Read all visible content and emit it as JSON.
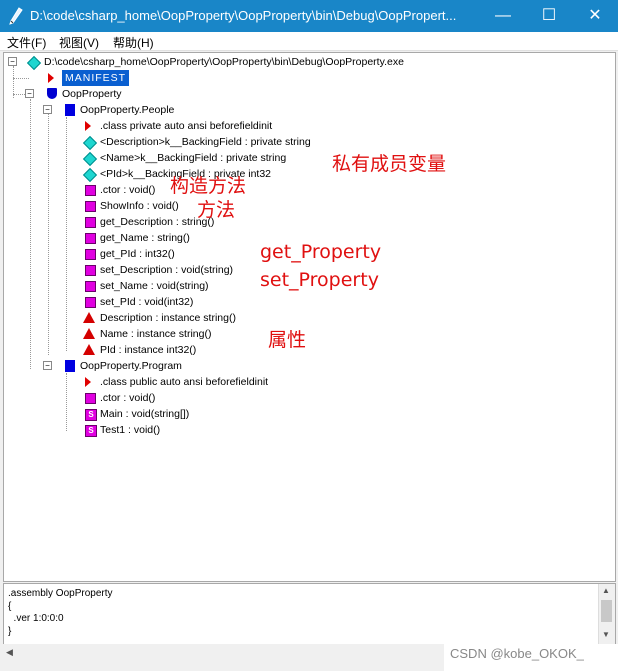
{
  "window": {
    "title": "D:\\code\\csharp_home\\OopProperty\\OopProperty\\bin\\Debug\\OopPropert...",
    "minimize": "—",
    "maximize": "☐",
    "close": "✕"
  },
  "menu": [
    {
      "label": "文件(F)"
    },
    {
      "label": "视图(V)"
    },
    {
      "label": "帮助(H)"
    }
  ],
  "tree": {
    "root": "D:\\code\\csharp_home\\OopProperty\\OopProperty\\bin\\Debug\\OopProperty.exe",
    "manifest": "MANIFEST",
    "namespace": "OopProperty",
    "people": {
      "name": "OopProperty.People",
      "members": [
        ".class private auto ansi beforefieldinit",
        "<Description>k__BackingField : private string",
        "<Name>k__BackingField : private string",
        "<PId>k__BackingField : private int32",
        ".ctor : void()",
        "ShowInfo : void()",
        "get_Description : string()",
        "get_Name : string()",
        "get_PId : int32()",
        "set_Description : void(string)",
        "set_Name : void(string)",
        "set_PId : void(int32)",
        "Description : instance string()",
        "Name : instance string()",
        "PId : instance int32()"
      ]
    },
    "program": {
      "name": "OopProperty.Program",
      "members": [
        ".class public auto ansi beforefieldinit",
        ".ctor : void()",
        "Main : void(string[])",
        "Test1 : void()"
      ]
    }
  },
  "annotations": {
    "private_fields": "私有成员变量",
    "ctor": "构造方法",
    "methods": "方法",
    "get_property": "get_Property",
    "set_property": "set_Property",
    "properties": "属性"
  },
  "icons": {
    "class_decl": "red-triangle-icon",
    "field": "cyan-diamond-icon",
    "method": "magenta-square-icon",
    "static_method": "static-method-icon",
    "property": "red-up-triangle-icon",
    "class": "blue-class-icon",
    "namespace": "blue-shield-icon"
  },
  "static_badge": "S",
  "bottom_panel": {
    "lines": [
      ".assembly OopProperty",
      "{",
      "  .ver 1:0:0:0",
      "}"
    ]
  },
  "watermark": "CSDN @kobe_OKOK_"
}
